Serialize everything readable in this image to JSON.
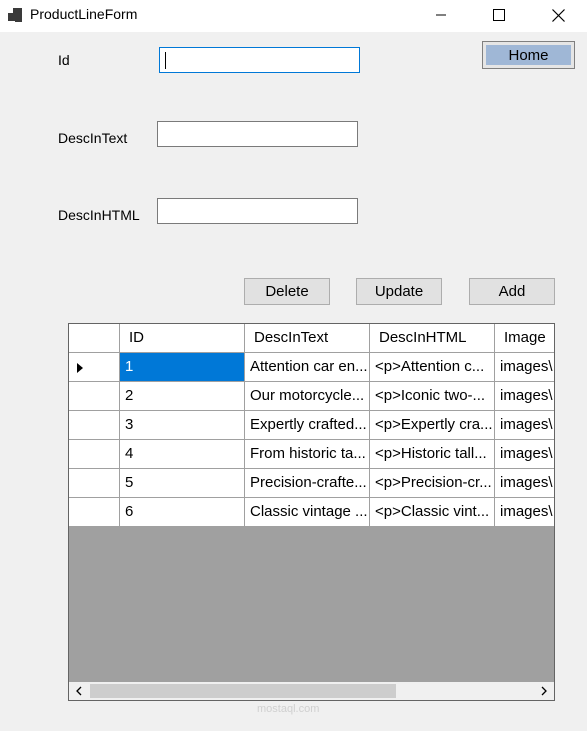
{
  "window": {
    "title": "ProductLineForm",
    "minimize_icon": "minimize-icon",
    "maximize_icon": "maximize-icon",
    "close_icon": "close-icon"
  },
  "form": {
    "id_label": "Id",
    "id_value": "",
    "desc_text_label": "DescInText",
    "desc_text_value": "",
    "desc_html_label": "DescInHTML",
    "desc_html_value": ""
  },
  "buttons": {
    "home": "Home",
    "delete": "Delete",
    "update": "Update",
    "add": "Add"
  },
  "grid": {
    "columns": [
      "ID",
      "DescInText",
      "DescInHTML",
      "Image"
    ],
    "rows": [
      [
        "1",
        "Attention car en...",
        "<p>Attention c...",
        "images\\"
      ],
      [
        "2",
        "Our motorcycle...",
        "<p>Iconic two-...",
        "images\\"
      ],
      [
        "3",
        "Expertly crafted...",
        "<p>Expertly cra...",
        "images\\"
      ],
      [
        "4",
        "From historic ta...",
        "<p>Historic tall...",
        "images\\"
      ],
      [
        "5",
        "Precision-crafte...",
        "<p>Precision-cr...",
        "images\\"
      ],
      [
        "6",
        "Classic vintage ...",
        "<p>Classic vint...",
        "images\\"
      ]
    ],
    "current_row_indicator": "row-pointer-icon",
    "selected_accent": "#0078d7"
  },
  "watermark": "mostaql.com"
}
